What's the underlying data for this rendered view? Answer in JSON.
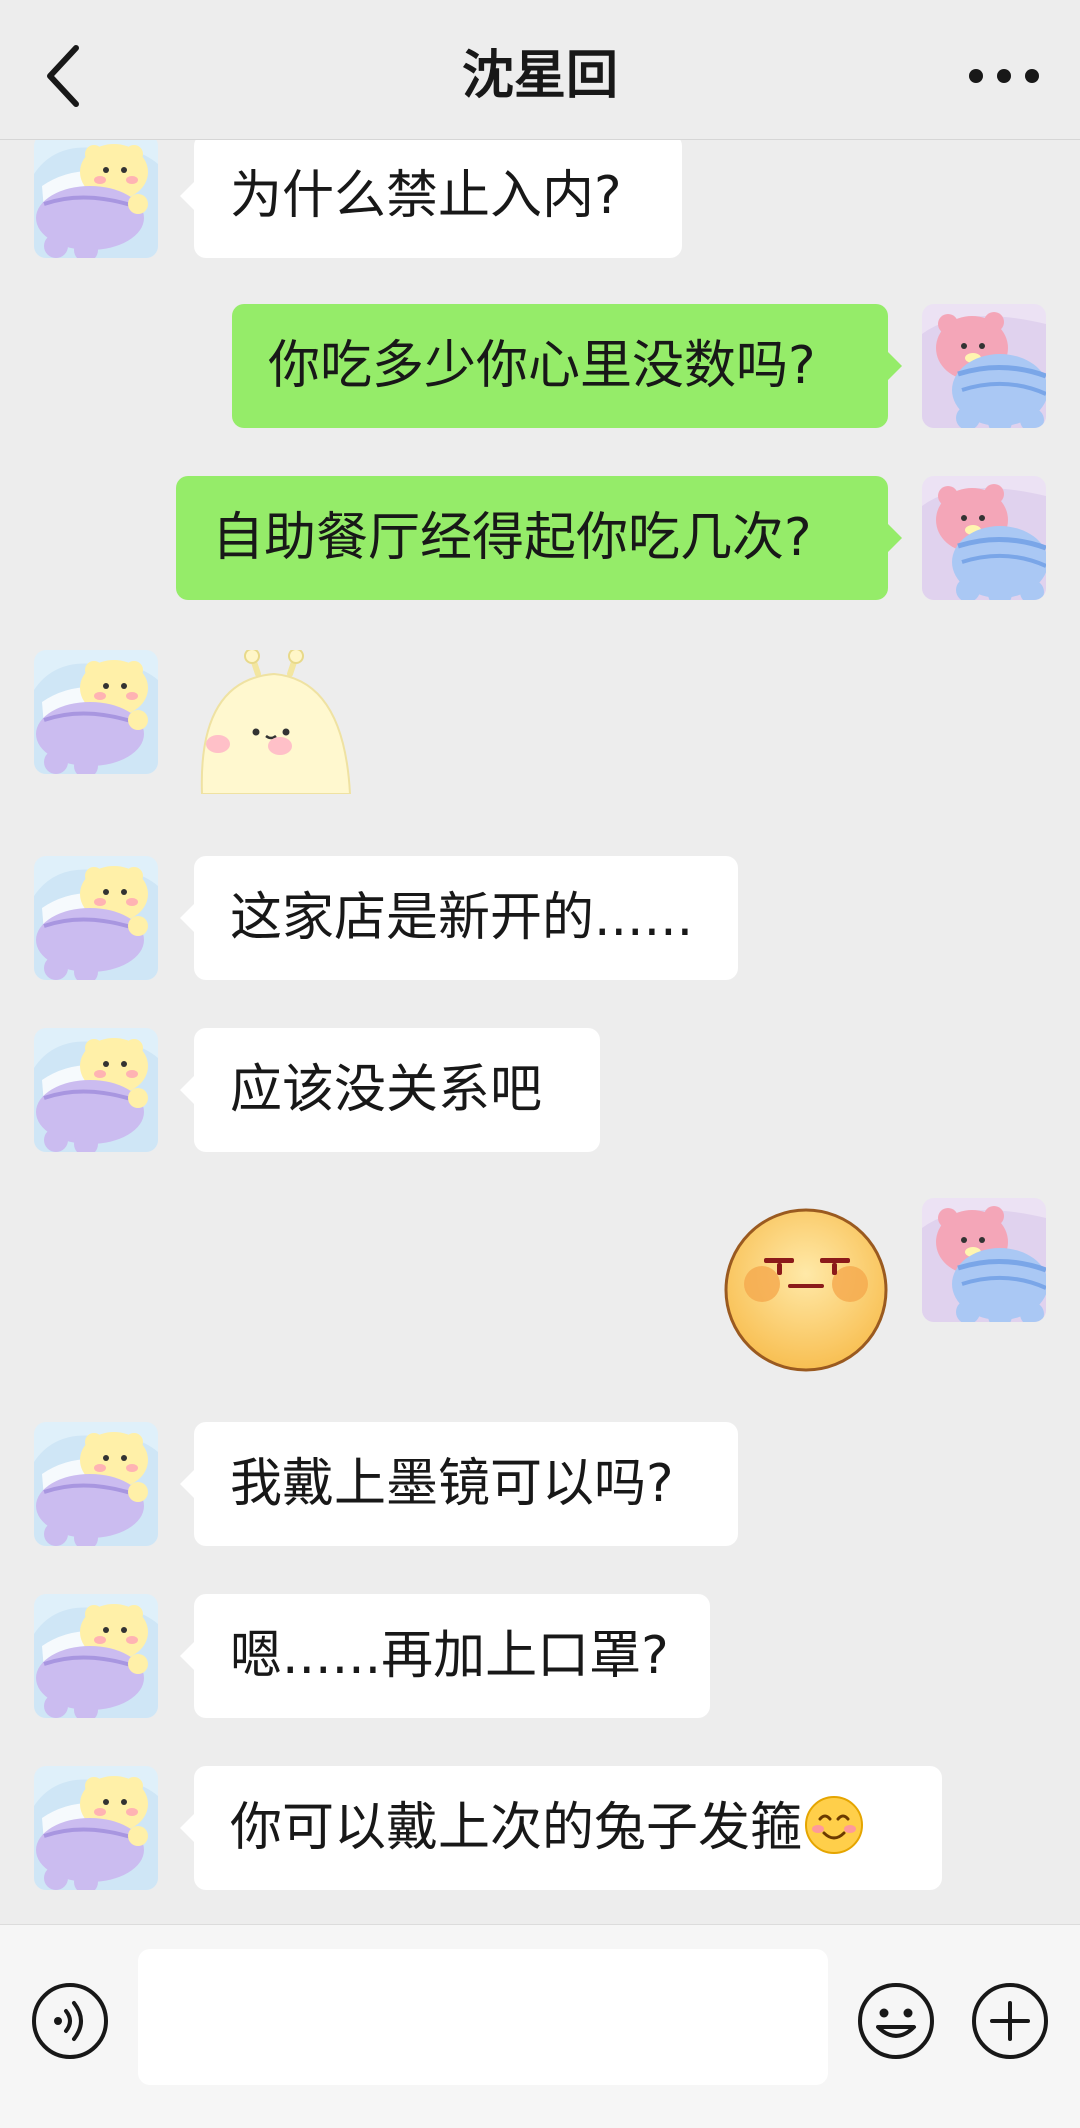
{
  "header": {
    "title": "沈星回",
    "back_icon": "chevron-left-icon",
    "more_icon": "more-dots-icon"
  },
  "colors": {
    "background": "#ededed",
    "bubble_incoming": "#ffffff",
    "bubble_outgoing": "#95ec69"
  },
  "messages": [
    {
      "from": "them",
      "type": "text",
      "text": "为什么禁止入内?"
    },
    {
      "from": "me",
      "type": "text",
      "text": "你吃多少你心里没数吗?"
    },
    {
      "from": "me",
      "type": "text",
      "text": "自助餐厅经得起你吃几次?"
    },
    {
      "from": "them",
      "type": "sticker",
      "sticker": "yellow-blob-sticker"
    },
    {
      "from": "them",
      "type": "text",
      "text": "这家店是新开的......"
    },
    {
      "from": "them",
      "type": "text",
      "text": "应该没关系吧"
    },
    {
      "from": "me",
      "type": "sticker",
      "sticker": "annoyed-face-emoji"
    },
    {
      "from": "them",
      "type": "text",
      "text": "我戴上墨镜可以吗?"
    },
    {
      "from": "them",
      "type": "text",
      "text": "嗯......再加上口罩?"
    },
    {
      "from": "them",
      "type": "text",
      "text": "你可以戴上次的兔子发箍",
      "emoji": "smiling-face-emoji"
    }
  ],
  "input_bar": {
    "message_value": "",
    "voice_icon": "voice-icon",
    "emoji_icon": "emoji-icon",
    "plus_icon": "plus-icon"
  }
}
